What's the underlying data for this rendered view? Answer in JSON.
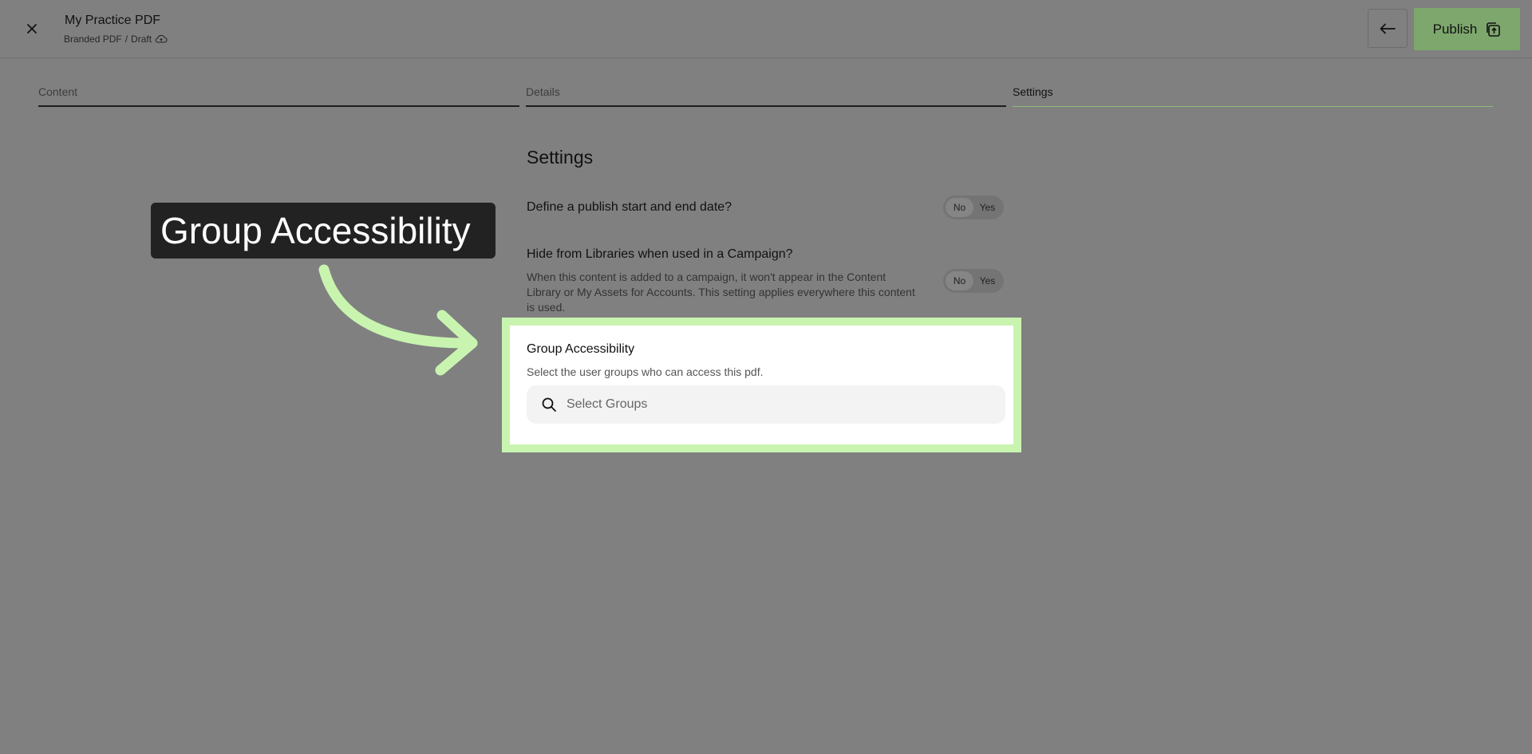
{
  "header": {
    "title": "My Practice PDF",
    "breadcrumb_type": "Branded PDF",
    "breadcrumb_sep": "/",
    "breadcrumb_status": "Draft",
    "publish_label": "Publish"
  },
  "tabs": [
    {
      "label": "Content",
      "active": false
    },
    {
      "label": "Details",
      "active": false
    },
    {
      "label": "Settings",
      "active": true
    }
  ],
  "settings": {
    "title": "Settings",
    "publish_dates": {
      "question": "Define a publish start and end date?",
      "no_label": "No",
      "yes_label": "Yes",
      "selected": "No"
    },
    "hide_from_libraries": {
      "question": "Hide from Libraries when used in a Campaign?",
      "description": "When this content is added to a campaign, it won't appear in the Content Library or My Assets for Accounts. This setting applies everywhere this content is used.",
      "no_label": "No",
      "yes_label": "Yes",
      "selected": "No"
    },
    "group_accessibility": {
      "title": "Group Accessibility",
      "description": "Select the user groups who can access this pdf.",
      "placeholder": "Select Groups",
      "value": ""
    }
  },
  "callout": {
    "text": "Group Accessibility"
  },
  "colors": {
    "overlay": "#808080",
    "highlight": "#c8f4b0",
    "publish_bg": "#7ea76e",
    "active_tab_line": "#8dbb78",
    "callout_bg": "#222222"
  },
  "icons": {
    "close": "close-icon",
    "cloud": "cloud-save-icon",
    "back": "arrow-left-icon",
    "publish": "publish-icon",
    "search": "search-icon",
    "arrow": "callout-arrow"
  }
}
